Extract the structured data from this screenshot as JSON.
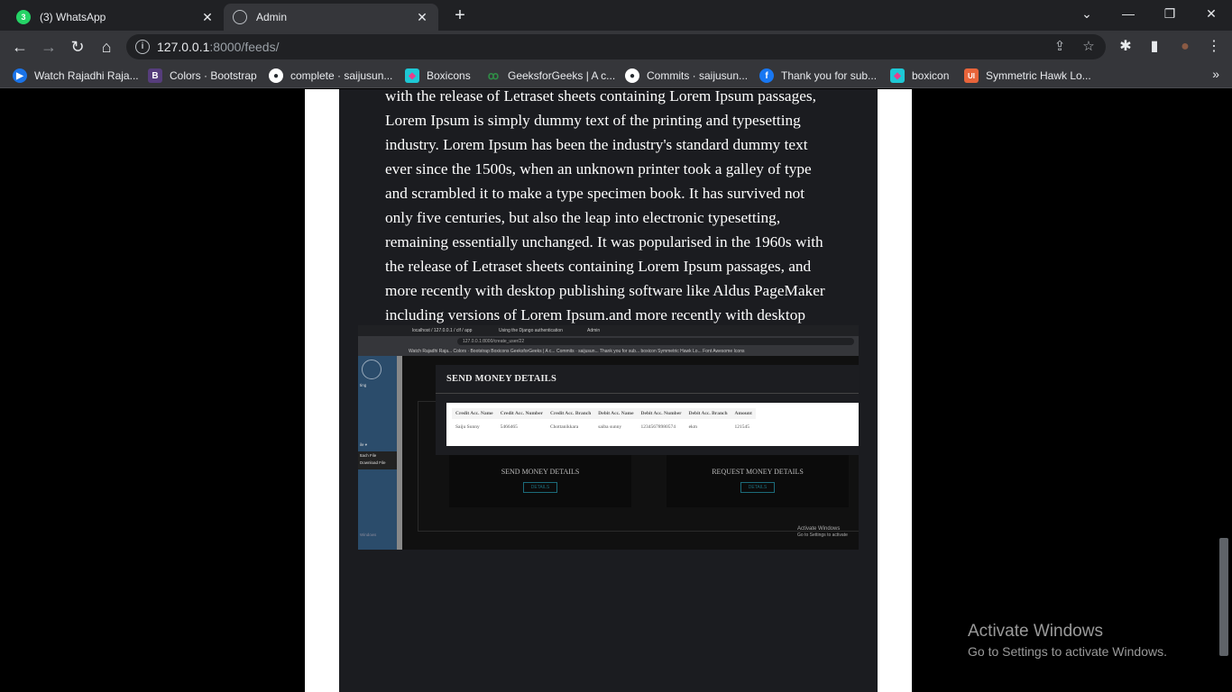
{
  "browser": {
    "tabs": [
      {
        "label": "(3) WhatsApp",
        "badge": "3",
        "close": "✕"
      },
      {
        "label": "Admin",
        "close": "✕"
      }
    ],
    "new_tab": "+",
    "window_controls": {
      "chevron": "⌄",
      "minimize": "—",
      "restore": "❐",
      "close": "✕"
    },
    "nav": {
      "back": "←",
      "forward": "→",
      "reload": "↻",
      "home": "⌂"
    },
    "url_host": "127.0.0.1",
    "url_rest": ":8000/feeds/",
    "info_icon": "i",
    "omni_icons": {
      "share": "⇪",
      "bookmark": "☆"
    },
    "right_icons": {
      "extensions": "✱",
      "sidepanel": "▮",
      "profile": "●",
      "menu": "⋮"
    },
    "bookmarks": [
      {
        "label": "Watch Rajadhi Raja...",
        "icon": "▶",
        "color": "#1a73e8"
      },
      {
        "label": "Colors · Bootstrap",
        "icon": "B",
        "color": "#563d7c"
      },
      {
        "label": "complete · saijusun...",
        "icon": "●",
        "color": "#24292e"
      },
      {
        "label": "Boxicons",
        "icon": "◆",
        "color": "#e83e8c"
      },
      {
        "label": "GeeksforGeeks | A c...",
        "icon": "ꝏ",
        "color": "#2f8d46"
      },
      {
        "label": "Commits · saijusun...",
        "icon": "●",
        "color": "#24292e"
      },
      {
        "label": "Thank you for sub...",
        "icon": "f",
        "color": "#1877f2"
      },
      {
        "label": "boxicon",
        "icon": "◆",
        "color": "#e83e8c"
      },
      {
        "label": "Symmetric Hawk Lo...",
        "icon": "UI",
        "color": "#e8643a"
      }
    ],
    "bookmarks_more": "»"
  },
  "post": {
    "body": "with the release of Letraset sheets containing Lorem Ipsum passages, Lorem Ipsum is simply dummy text of the printing and typesetting industry. Lorem Ipsum has been the industry's standard dummy text ever since the 1500s, when an unknown printer took a galley of type and scrambled it to make a type specimen book. It has survived not only five centuries, but also the leap into electronic typesetting, remaining essentially unchanged. It was popularised in the 1960s with the release of Letraset sheets containing Lorem Ipsum passages, and more recently with desktop publishing software like Aldus PageMaker including versions of Lorem Ipsum.and more recently with desktop publishing software like Aldus PageMaker including versions of Lorem Ipsum."
  },
  "embedded_screenshot": {
    "tabs": [
      "localhost / 127.0.0.1 / clf / app",
      "Using the Django authentication",
      "Admin"
    ],
    "url": "127.0.0.1:8000/create_user/22",
    "bookmarks": "Watch Rajadhi Raja...   Colors · Bootstrap   Boxicons   GeeksforGeeks | A c...   Commits · saijusun...   Thank you for sub...   boxicon   Symmetric Hawk Lo...   Font Awesome Icons",
    "sidebar_items": [
      "ting",
      "ile ▾",
      "ttach File",
      "Download File",
      "Windows"
    ],
    "modal_title": "SEND MONEY DETAILS",
    "table_headers": [
      "Credit Acc. Name",
      "Credit Acc. Number",
      "Credit Acc. Branch",
      "Debit Acc. Name",
      "Debit Acc. Number",
      "Debit Acc. Branch",
      "Amount"
    ],
    "table_row": [
      "Saiju Sunny",
      "5466465",
      "Chottanikkara",
      "saiba sunny",
      "12345678980574",
      "ekm",
      "121545"
    ],
    "cards": [
      {
        "title": "SEND MONEY DETAILS",
        "button": "DETAILS"
      },
      {
        "title": "REQUEST MONEY DETAILS",
        "button": "DETAILS"
      }
    ],
    "watermark": [
      "Activate Windows",
      "Go to Settings to activate"
    ]
  },
  "activation": {
    "title": "Activate Windows",
    "subtitle": "Go to Settings to activate Windows."
  }
}
